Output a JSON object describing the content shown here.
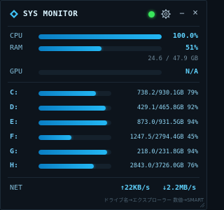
{
  "app": {
    "title": "SYS MONITOR"
  },
  "system": {
    "cpu": {
      "label": "CPU",
      "value": "100.0%",
      "level": 1.0
    },
    "ram": {
      "label": "RAM",
      "value": "51%",
      "level": 0.51,
      "detail": "24.6 / 47.9 GB"
    },
    "gpu": {
      "label": "GPU",
      "value": "N/A",
      "level": 0.0
    }
  },
  "drives": [
    {
      "letter": "C:",
      "info": "738.2/930.1GB 79%",
      "level": 0.79
    },
    {
      "letter": "D:",
      "info": "429.1/465.8GB 92%",
      "level": 0.92
    },
    {
      "letter": "E:",
      "info": "873.0/931.5GB 94%",
      "level": 0.94
    },
    {
      "letter": "F:",
      "info": "1247.5/2794.4GB 45%",
      "level": 0.45
    },
    {
      "letter": "G:",
      "info": "218.0/231.8GB 94%",
      "level": 0.94
    },
    {
      "letter": "H:",
      "info": "2843.0/3726.0GB 76%",
      "level": 0.76
    }
  ],
  "network": {
    "label": "NET",
    "upload": "↑22KB/s",
    "download": "↓2.2MB/s"
  },
  "footer": {
    "text": "ドライブ名→エクスプローラー 数値→SMART"
  },
  "colors": {
    "accent": "#23b7f3",
    "status": "#39e65b",
    "background": "#0d141c"
  },
  "icons": {
    "logo": "diamond-icon",
    "settings": "gear-icon",
    "minimize": "minimize-icon",
    "close": "close-icon"
  }
}
